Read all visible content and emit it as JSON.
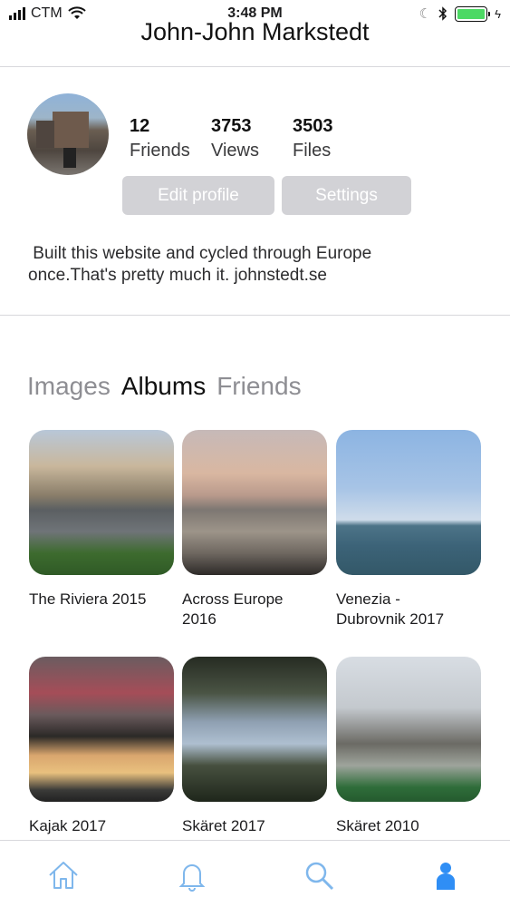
{
  "status_bar": {
    "carrier": "CTM",
    "time": "3:48 PM",
    "icons": [
      "signal-icon",
      "wifi-icon",
      "moon-icon",
      "bluetooth-icon",
      "battery-icon",
      "charging-icon"
    ],
    "battery_fill": 1.0,
    "battery_color": "#4cd964"
  },
  "header": {
    "title": "John-John Markstedt"
  },
  "profile": {
    "avatar_icon": "avatar",
    "stats": [
      {
        "value": "12",
        "label": "Friends"
      },
      {
        "value": "3753",
        "label": "Views"
      },
      {
        "value": "3503",
        "label": "Files"
      }
    ],
    "edit_label": "Edit profile",
    "settings_label": "Settings",
    "bio_line1": " Built this website and cycled through Europe",
    "bio_line2": "once.That's pretty much it. johnstedt.se"
  },
  "tabs": [
    {
      "label": "Images",
      "active": false
    },
    {
      "label": "Albums",
      "active": true
    },
    {
      "label": "Friends",
      "active": false
    }
  ],
  "albums": [
    {
      "title_line1": "The Riviera 2015",
      "title_line2": ""
    },
    {
      "title_line1": "Across Europe",
      "title_line2": "2016"
    },
    {
      "title_line1": "Venezia -",
      "title_line2": "Dubrovnik 2017"
    },
    {
      "title_line1": "Kajak 2017",
      "title_line2": ""
    },
    {
      "title_line1": "Skäret 2017",
      "title_line2": ""
    },
    {
      "title_line1": "Skäret 2010",
      "title_line2": ""
    }
  ],
  "tab_bar": {
    "items": [
      "home-icon",
      "bell-icon",
      "search-icon",
      "profile-icon"
    ],
    "accent": "#2f8ef5",
    "inactive": "#7fb7ec"
  }
}
